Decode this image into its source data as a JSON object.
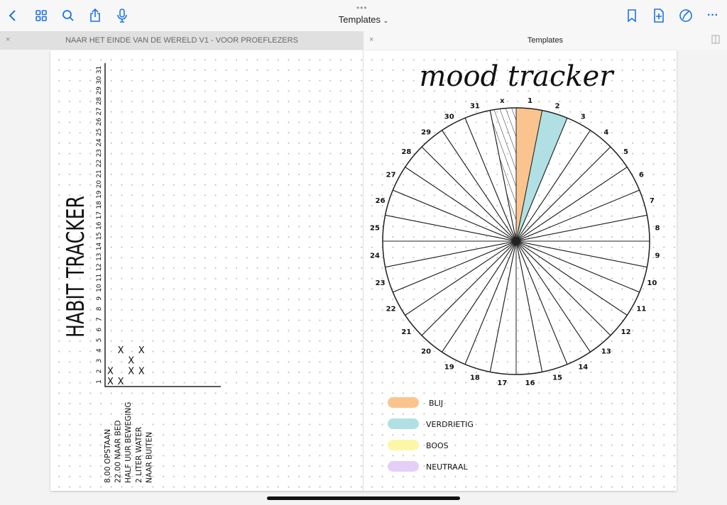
{
  "toolbar": {
    "title": "Templates",
    "icons": [
      "back-icon",
      "grid-icon",
      "search-icon",
      "share-icon",
      "microphone-icon",
      "bookmark-icon",
      "add-page-icon",
      "pen-off-icon",
      "more-icon"
    ]
  },
  "tabs": [
    {
      "label": "NAAR HET EINDE VAN DE WERELD  V1 - VOOR PROEFLEZERS",
      "close": "×"
    },
    {
      "label": "Templates",
      "close": "×"
    }
  ],
  "habit_tracker": {
    "title": "HABIT TRACKER",
    "days": 31,
    "habits": [
      {
        "label": "8.00  OPSTAAN",
        "checked": [
          1,
          2
        ]
      },
      {
        "label": "22.00 NAAR BED",
        "checked": [
          1,
          4
        ]
      },
      {
        "label": "HALF UUR BEWEGING",
        "checked": [
          2,
          3
        ]
      },
      {
        "label": "2 LITER WATER",
        "checked": [
          2,
          4
        ]
      },
      {
        "label": "NAAR BUITEN",
        "checked": []
      }
    ],
    "mark": "X"
  },
  "mood_tracker": {
    "title": "mood tracker",
    "extra_label": "x",
    "days": [
      {
        "day": 1,
        "mood": "BLIJ"
      },
      {
        "day": 2,
        "mood": "VERDRIETIG"
      }
    ],
    "legend": [
      {
        "label": "BLIJ",
        "color": "#fbc48f"
      },
      {
        "label": "VERDRIETIG",
        "color": "#b0e0e3"
      },
      {
        "label": "BOOS",
        "color": "#fbf7a6"
      },
      {
        "label": "NEUTRAAL",
        "color": "#e3cff7"
      }
    ]
  },
  "colors": {
    "accent": "#1a73e8"
  }
}
